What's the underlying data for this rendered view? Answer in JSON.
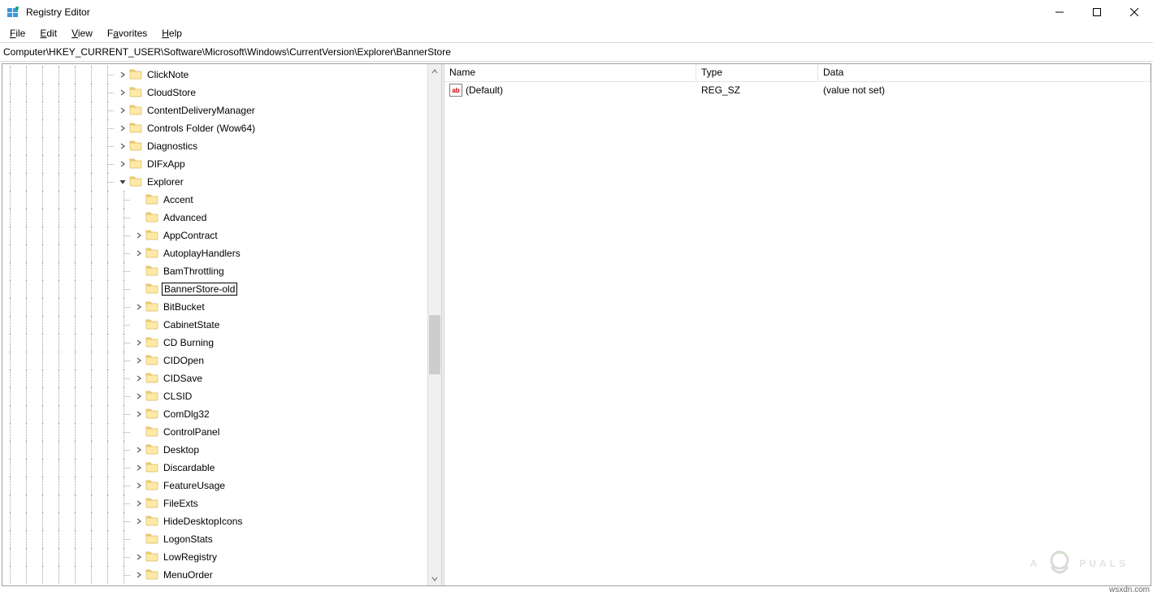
{
  "window": {
    "title": "Registry Editor"
  },
  "menus": {
    "file": "File",
    "edit": "Edit",
    "view": "View",
    "favorites": "Favorites",
    "help": "Help"
  },
  "address": "Computer\\HKEY_CURRENT_USER\\Software\\Microsoft\\Windows\\CurrentVersion\\Explorer\\BannerStore",
  "tree": {
    "nodes": [
      {
        "label": "ClickNote",
        "depth": 7,
        "chev": "right"
      },
      {
        "label": "CloudStore",
        "depth": 7,
        "chev": "right"
      },
      {
        "label": "ContentDeliveryManager",
        "depth": 7,
        "chev": "right"
      },
      {
        "label": "Controls Folder (Wow64)",
        "depth": 7,
        "chev": "right"
      },
      {
        "label": "Diagnostics",
        "depth": 7,
        "chev": "right"
      },
      {
        "label": "DIFxApp",
        "depth": 7,
        "chev": "right"
      },
      {
        "label": "Explorer",
        "depth": 7,
        "chev": "down"
      },
      {
        "label": "Accent",
        "depth": 8,
        "chev": "none"
      },
      {
        "label": "Advanced",
        "depth": 8,
        "chev": "none"
      },
      {
        "label": "AppContract",
        "depth": 8,
        "chev": "right"
      },
      {
        "label": "AutoplayHandlers",
        "depth": 8,
        "chev": "right"
      },
      {
        "label": "BamThrottling",
        "depth": 8,
        "chev": "none"
      },
      {
        "label": "BannerStore-old",
        "depth": 8,
        "chev": "none",
        "editing": true
      },
      {
        "label": "BitBucket",
        "depth": 8,
        "chev": "right"
      },
      {
        "label": "CabinetState",
        "depth": 8,
        "chev": "none"
      },
      {
        "label": "CD Burning",
        "depth": 8,
        "chev": "right"
      },
      {
        "label": "CIDOpen",
        "depth": 8,
        "chev": "right"
      },
      {
        "label": "CIDSave",
        "depth": 8,
        "chev": "right"
      },
      {
        "label": "CLSID",
        "depth": 8,
        "chev": "right"
      },
      {
        "label": "ComDlg32",
        "depth": 8,
        "chev": "right"
      },
      {
        "label": "ControlPanel",
        "depth": 8,
        "chev": "none"
      },
      {
        "label": "Desktop",
        "depth": 8,
        "chev": "right"
      },
      {
        "label": "Discardable",
        "depth": 8,
        "chev": "right"
      },
      {
        "label": "FeatureUsage",
        "depth": 8,
        "chev": "right"
      },
      {
        "label": "FileExts",
        "depth": 8,
        "chev": "right"
      },
      {
        "label": "HideDesktopIcons",
        "depth": 8,
        "chev": "right"
      },
      {
        "label": "LogonStats",
        "depth": 8,
        "chev": "none"
      },
      {
        "label": "LowRegistry",
        "depth": 8,
        "chev": "right"
      },
      {
        "label": "MenuOrder",
        "depth": 8,
        "chev": "right"
      }
    ]
  },
  "list": {
    "columns": {
      "name": "Name",
      "type": "Type",
      "data": "Data"
    },
    "rows": [
      {
        "name": "(Default)",
        "type": "REG_SZ",
        "data": "(value not set)"
      }
    ],
    "reg_icon_text": "ab"
  },
  "watermark": {
    "left": "A",
    "right": "PUALS"
  },
  "footer": "wsxdn.com"
}
